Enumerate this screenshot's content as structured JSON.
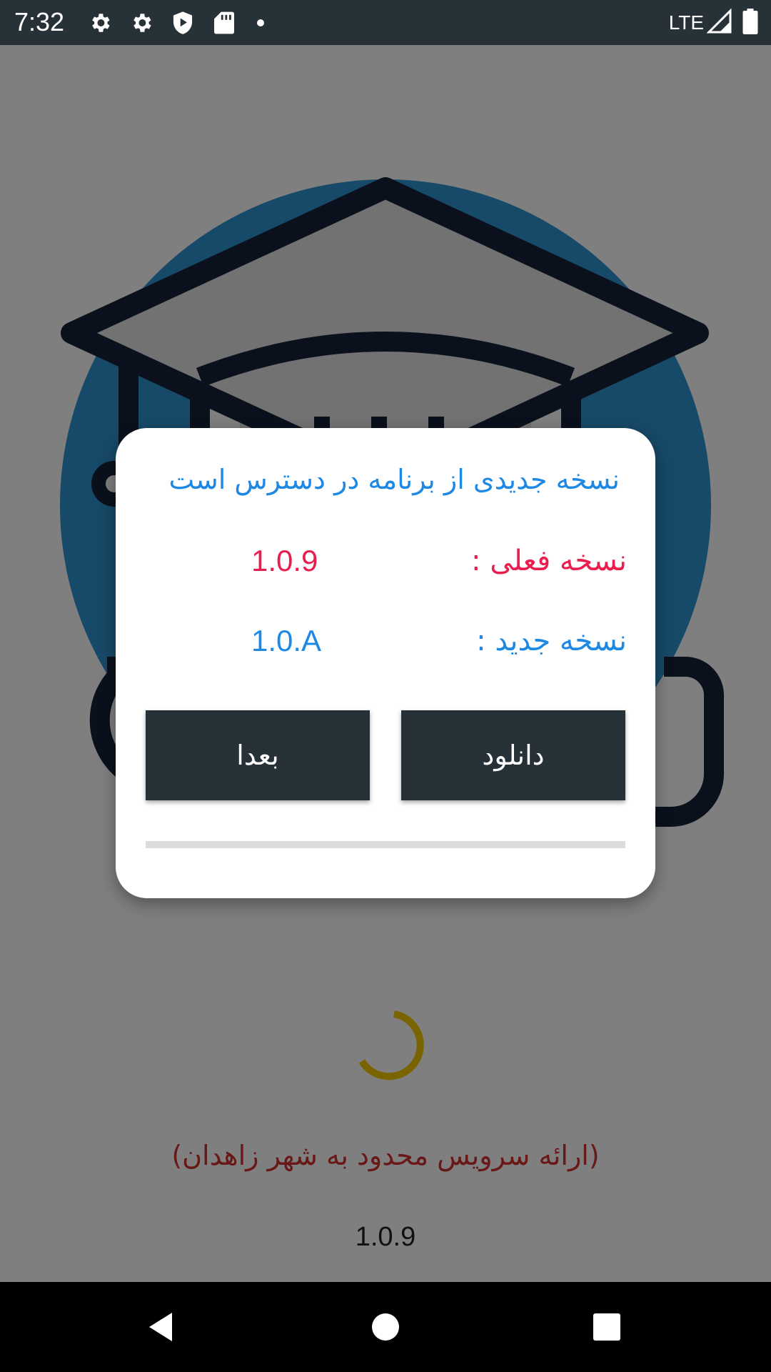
{
  "status_bar": {
    "time": "7:32",
    "network": "LTE",
    "icons": [
      "settings-icon",
      "settings-icon",
      "play-shield-icon",
      "sd-card-icon",
      "notification-dot",
      "signal-icon",
      "battery-icon"
    ]
  },
  "app": {
    "logo_icon": "graduation-cap-logo",
    "service_note": "(ارائه سرویس محدود به شهر زاهدان)",
    "version": "1.0.9",
    "colors": {
      "logo_circle": "#2E93D1",
      "spinner": "#F5C800",
      "note": "#D32F2F"
    }
  },
  "dialog": {
    "title": "نسخه جدیدی از برنامه در دسترس است",
    "current_label": "نسخه فعلی :",
    "current_value": "1.0.9",
    "new_label": "نسخه جدید :",
    "new_value": "1.0.A",
    "download_button": "دانلود",
    "later_button": "بعدا",
    "download_progress": 0,
    "colors": {
      "title": "#1E88E5",
      "current": "#E91E4F",
      "new": "#1E88E5",
      "button_bg": "#263238"
    }
  },
  "nav_bar": {
    "buttons": [
      "back-icon",
      "home-icon",
      "recents-icon"
    ]
  }
}
